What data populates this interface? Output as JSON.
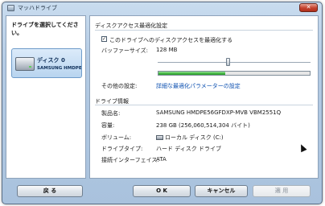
{
  "window": {
    "title": "マッハドライブ",
    "close_label": "✕"
  },
  "left": {
    "title": "ドライブを選択してください。",
    "drive": {
      "name": "ディスク 0",
      "model": "SAMSUNG HMDPE..."
    }
  },
  "settings": {
    "section_title": "ディスクアクセス最適化設定",
    "checkbox_checked": true,
    "checkbox_mark": "✓",
    "checkbox_label": "このドライブへのディスクアクセスを最適化する",
    "buffer_label": "バッファーサイズ:",
    "buffer_value": "128 MB",
    "slider_level": 0.46,
    "progress_level": 0.44,
    "other_label": "その他の設定:",
    "other_link": "詳細な最適化パラメーターの設定"
  },
  "drive_info": {
    "section_title": "ドライブ情報",
    "rows": [
      {
        "label": "製品名:",
        "value": "SAMSUNG HMDPE56GFDXP-MVB  VBM2551Q"
      },
      {
        "label": "容量:",
        "value": "238  GB (256,060,514,304 バイト)"
      },
      {
        "label": "ボリューム:",
        "value": "ローカル ディスク (C:)"
      },
      {
        "label": "ドライブタイプ:",
        "value": "ハード ディスク ドライブ"
      },
      {
        "label": "接続インターフェイス:",
        "value": "ATA"
      }
    ]
  },
  "buttons": {
    "back": "戻 る",
    "ok": "O K",
    "cancel": "キャンセル",
    "apply": "適 用"
  }
}
